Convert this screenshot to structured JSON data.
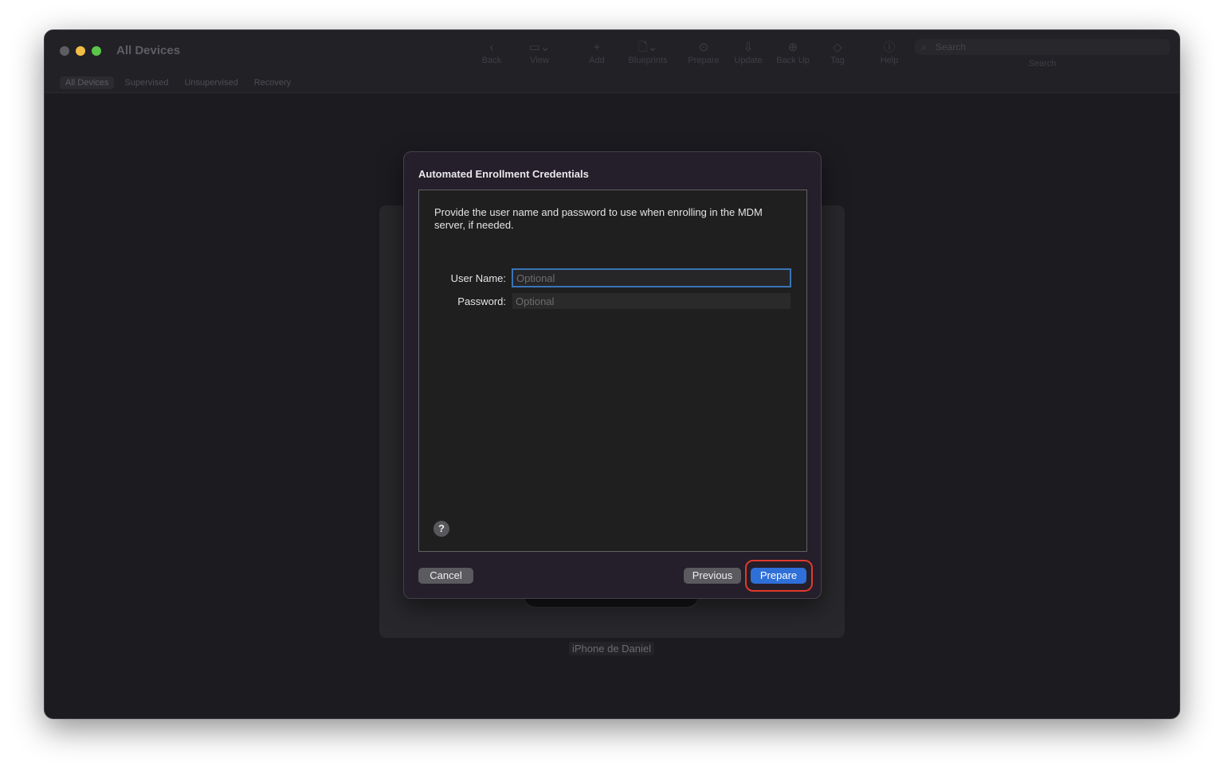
{
  "window": {
    "title": "All Devices"
  },
  "toolbar": {
    "items": [
      {
        "label": "Back",
        "icon": "chevron-left-icon"
      },
      {
        "label": "View",
        "icon": "view-icon"
      },
      {
        "label": "Add",
        "icon": "plus-icon"
      },
      {
        "label": "Blueprints",
        "icon": "blueprint-icon"
      },
      {
        "label": "Prepare",
        "icon": "prepare-icon"
      },
      {
        "label": "Update",
        "icon": "update-icon"
      },
      {
        "label": "Back Up",
        "icon": "backup-icon"
      },
      {
        "label": "Tag",
        "icon": "tag-icon"
      },
      {
        "label": "Help",
        "icon": "help-icon"
      }
    ],
    "search_placeholder": "Search",
    "search_label": "Search"
  },
  "tabs": [
    "All Devices",
    "Supervised",
    "Unsupervised",
    "Recovery"
  ],
  "device": {
    "name": "iPhone de Daniel"
  },
  "dialog": {
    "title": "Automated Enrollment Credentials",
    "description": "Provide the user name and password to use when enrolling in the MDM server, if needed.",
    "username_label": "User Name:",
    "username_placeholder": "Optional",
    "password_label": "Password:",
    "password_placeholder": "Optional",
    "help": "?",
    "cancel": "Cancel",
    "previous": "Previous",
    "prepare": "Prepare"
  },
  "colors": {
    "accent": "#2f6fd8",
    "highlight": "#e03a2b"
  }
}
